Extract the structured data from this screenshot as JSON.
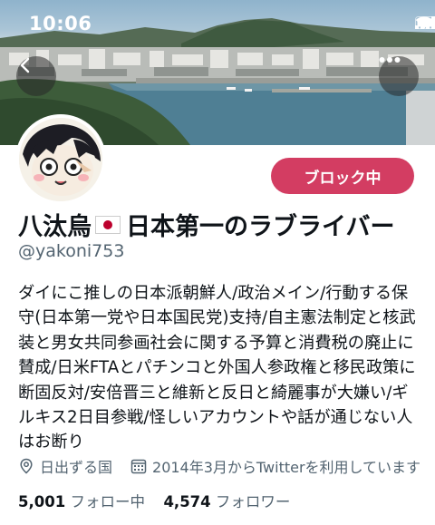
{
  "status_bar": {
    "time": "10:06"
  },
  "profile": {
    "name_before_flag": "八汰烏",
    "name_after_flag": "日本第一のラブライバー",
    "handle": "@yakoni753",
    "block_button_label": "ブロック中",
    "bio": "ダイにこ推しの日本派朝鮮人/政治メイン/行動する保守(日本第一党や日本国民党)支持/自主憲法制定と核武装と男女共同参画社会に関する予算と消費税の廃止に賛成/日米FTAとパチンコと外国人参政権と移民政策に断固反対/安倍晋三と維新と反日と綺麗事が大嫌い/ギルキス2日目参戦/怪しいアカウントや話が通じない人はお断り",
    "location": "日出ずる国",
    "joined": "2014年3月からTwitterを利用しています",
    "following_count": "5,001",
    "following_label": "フォロー中",
    "followers_count": "4,574",
    "followers_label": "フォロワー"
  },
  "colors": {
    "block_button": "#d33d62",
    "secondary_text": "#536471",
    "flag_red": "#bc002d"
  },
  "icons": [
    "back-arrow-icon",
    "more-icon",
    "location-icon",
    "calendar-icon",
    "signal-icon",
    "wifi-icon",
    "battery-icon",
    "flag-japan-icon"
  ]
}
